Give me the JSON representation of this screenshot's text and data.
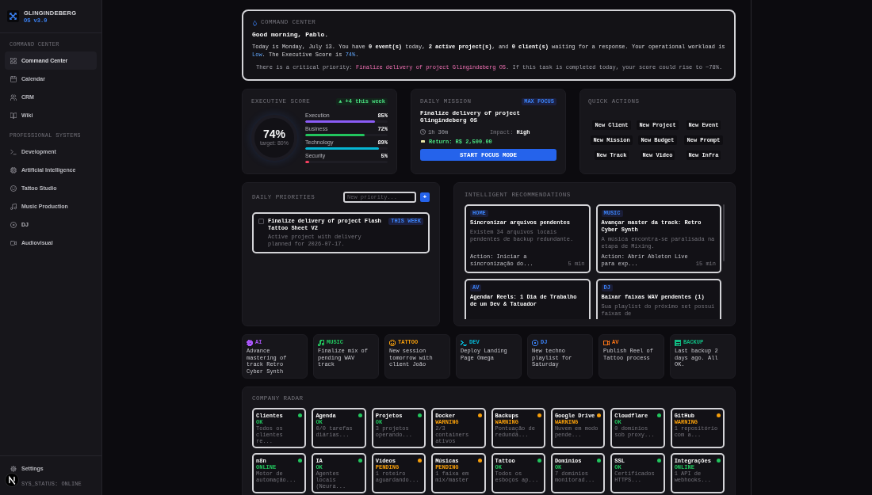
{
  "sidebar": {
    "brand": {
      "name": "GLINGINDEBERG",
      "version": "OS v3.0"
    },
    "sections": [
      {
        "title": "COMMAND CENTER",
        "items": [
          {
            "label": "Command Center",
            "selected": true
          },
          {
            "label": "Calendar",
            "selected": false
          },
          {
            "label": "CRM",
            "selected": false
          },
          {
            "label": "Wiki",
            "selected": false
          }
        ]
      },
      {
        "title": "PROFESSIONAL SYSTEMS",
        "items": [
          {
            "label": "Development",
            "selected": false
          },
          {
            "label": "Artificial Intelligence",
            "selected": false
          },
          {
            "label": "Tattoo Studio",
            "selected": false
          },
          {
            "label": "Music Production",
            "selected": false
          },
          {
            "label": "DJ",
            "selected": false
          },
          {
            "label": "Audiovisual",
            "selected": false
          }
        ]
      }
    ],
    "settings": "Settings",
    "status": "SYS_STATUS: ONLINE"
  },
  "command_center": {
    "title": "COMMAND CENTER",
    "greeting": "Good morning, Pablo.",
    "summary": [
      {
        "text": "Today is Monday, July 13. You have ",
        "kind": "plain"
      },
      {
        "text": "0 event(s)",
        "kind": "bold"
      },
      {
        "text": " today, ",
        "kind": "plain"
      },
      {
        "text": "2 active project(s)",
        "kind": "bold"
      },
      {
        "text": ", and ",
        "kind": "plain"
      },
      {
        "text": "0 client(s)",
        "kind": "bold"
      },
      {
        "text": " waiting for a response. Your operational workload is ",
        "kind": "plain"
      },
      {
        "text": "Low",
        "kind": "accent"
      },
      {
        "text": ". The Executive Score is ",
        "kind": "plain"
      },
      {
        "text": "74%",
        "kind": "accent"
      },
      {
        "text": ".",
        "kind": "plain"
      }
    ],
    "alert": [
      {
        "text": "There is a critical priority: ",
        "kind": "plain"
      },
      {
        "text": "Finalize delivery of project Glingindeberg OS",
        "kind": "critical"
      },
      {
        "text": ". If this task is completed today, your score could rise to ~78%.",
        "kind": "plain"
      }
    ]
  },
  "executive_score": {
    "title": "EXECUTIVE SCORE",
    "trend": "▲ +4 this week",
    "score": "74%",
    "target": "target: 80%",
    "metrics": [
      {
        "label": "Execution",
        "value": "85%",
        "level": 0.85,
        "color": "#8b5cf6"
      },
      {
        "label": "Business",
        "value": "72%",
        "level": 0.72,
        "color": "#22c55e"
      },
      {
        "label": "Technology",
        "value": "89%",
        "level": 0.89,
        "color": "#06b6d4"
      },
      {
        "label": "Security",
        "value": "5%",
        "level": 0.05,
        "color": "#f43f5e"
      }
    ]
  },
  "daily_mission": {
    "title": "DAILY MISSION",
    "badge": "MAX FOCUS",
    "task": "Finalize delivery of project Glingindeberg OS",
    "duration": "1h 30m",
    "impact_label": "Impact:",
    "impact": "High",
    "return": "Return: R$ 2,500.00",
    "button": "START FOCUS MODE"
  },
  "quick_actions": {
    "title": "QUICK ACTIONS",
    "actions": [
      "New Client",
      "New Project",
      "New Event",
      "New Mission",
      "New Budget",
      "New Prompt",
      "New Track",
      "New Video",
      "New Infra"
    ]
  },
  "daily_priorities": {
    "title": "DAILY PRIORITIES",
    "input": {
      "placeholder": "New priority..."
    },
    "add_button": "+",
    "items": [
      {
        "title": "Finalize delivery of project Flash Tattoo Sheet V2",
        "subtitle": "Active project with delivery planned for 2026-07-17.",
        "badge": "THIS WEEK",
        "checked": false
      }
    ]
  },
  "recommendations": {
    "title": "INTELLIGENT RECOMMENDATIONS",
    "cards": [
      {
        "tag": "HOME",
        "title": "Sincronizar arquivos pendentes",
        "description": "Existem 34 arquivos locais pendentes de backup redundante.",
        "action": "Action: Iniciar a sincronização do...",
        "time": "5 min"
      },
      {
        "tag": "MUSIC",
        "title": "Avançar master da track: Retro Cyber Synth",
        "description": "A música encontra-se paralisada na etapa de Mixing.",
        "action": "Action: Abrir Ableton Live para exp...",
        "time": "15 min"
      },
      {
        "tag": "AV",
        "title": "Agendar Reels: 1 Dia de Trabalho de um Dev & Tatuador"
      },
      {
        "tag": "DJ",
        "title": "Baixar faixas WAV pendentes (1)",
        "description": "Sua playlist do próximo set possui faixas de"
      }
    ]
  },
  "signals": [
    {
      "tag": "AI",
      "text": "Advance mastering of track Retro Cyber Synth",
      "color": "#a855f7"
    },
    {
      "tag": "MUSIC",
      "text": "Finalize mix of pending WAV track",
      "color": "#22c55e"
    },
    {
      "tag": "TATTOO",
      "text": "New session tomorrow with client João",
      "color": "#f59e0b"
    },
    {
      "tag": "DEV",
      "text": "Deploy Landing Page Omega",
      "color": "#06b6d4"
    },
    {
      "tag": "DJ",
      "text": "New techno playlist for Saturday",
      "color": "#3b82f6"
    },
    {
      "tag": "AV",
      "text": "Publish Reel of Tattoo process",
      "color": "#f97316"
    },
    {
      "tag": "BACKUP",
      "text": "Last backup 2 days ago. All OK.",
      "color": "#10b981"
    }
  ],
  "company_radar": {
    "title": "COMPANY RADAR",
    "items": [
      {
        "name": "Clientes",
        "status": "OK",
        "description": "Todos os clientes re...",
        "color": "#22c55e"
      },
      {
        "name": "Agenda",
        "status": "OK",
        "description": "0/0 tarefas diárias...",
        "color": "#22c55e"
      },
      {
        "name": "Projetos",
        "status": "OK",
        "description": "3 projetos operando...",
        "color": "#22c55e"
      },
      {
        "name": "Docker",
        "status": "WARNING",
        "description": "2/3 containers ativos",
        "color": "#f59e0b"
      },
      {
        "name": "Backups",
        "status": "WARNING",
        "description": "Pontuação de redundâ...",
        "color": "#f59e0b"
      },
      {
        "name": "Google Drive",
        "status": "WARNING",
        "description": "Nuvem em modo pende...",
        "color": "#f59e0b"
      },
      {
        "name": "Cloudflare",
        "status": "OK",
        "description": "0 domínios sob proxy...",
        "color": "#22c55e"
      },
      {
        "name": "GitHub",
        "status": "WARNING",
        "description": "1 repositório com a...",
        "color": "#f59e0b"
      },
      {
        "name": "n8n",
        "status": "ONLINE",
        "description": "Motor de automação...",
        "color": "#22c55e"
      },
      {
        "name": "IA",
        "status": "OK",
        "description": "Agentes locais (Neura...",
        "color": "#22c55e"
      },
      {
        "name": "Vídeos",
        "status": "PENDING",
        "description": "1 roteiro aguardando...",
        "color": "#f59e0b"
      },
      {
        "name": "Músicas",
        "status": "PENDING",
        "description": "1 faixa em mix/master",
        "color": "#f59e0b"
      },
      {
        "name": "Tattoo",
        "status": "OK",
        "description": "Todos os esboços ap...",
        "color": "#22c55e"
      },
      {
        "name": "Domínios",
        "status": "OK",
        "description": "7 domínios monitorad...",
        "color": "#22c55e"
      },
      {
        "name": "SSL",
        "status": "OK",
        "description": "Certificados HTTPS...",
        "color": "#22c55e"
      },
      {
        "name": "Integrações",
        "status": "ONLINE",
        "description": "1 API de webhooks...",
        "color": "#22c55e"
      }
    ]
  }
}
